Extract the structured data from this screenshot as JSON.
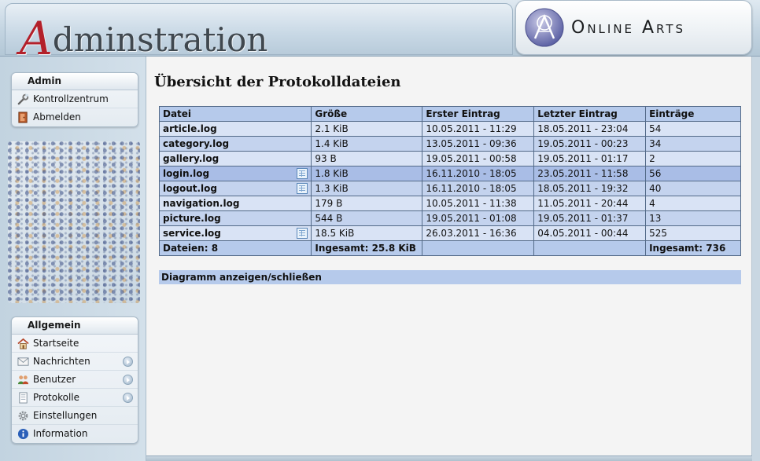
{
  "header": {
    "title_initial": "A",
    "title_rest": "dminstration",
    "brand_name": "Online Arts"
  },
  "sidebar": {
    "admin_panel": {
      "title": "Admin",
      "items": [
        {
          "label": "Kontrollzentrum",
          "icon": "wrench-icon",
          "arrow": false
        },
        {
          "label": "Abmelden",
          "icon": "logout-door-icon",
          "arrow": false
        }
      ]
    },
    "general_panel": {
      "title": "Allgemein",
      "items": [
        {
          "label": "Startseite",
          "icon": "home-icon",
          "arrow": false
        },
        {
          "label": "Nachrichten",
          "icon": "mail-icon",
          "arrow": true
        },
        {
          "label": "Benutzer",
          "icon": "users-icon",
          "arrow": true
        },
        {
          "label": "Protokolle",
          "icon": "document-icon",
          "arrow": true
        },
        {
          "label": "Einstellungen",
          "icon": "gear-icon",
          "arrow": false
        },
        {
          "label": "Information",
          "icon": "info-icon",
          "arrow": false
        }
      ]
    }
  },
  "main": {
    "page_title": "Übersicht der Protokolldateien",
    "table": {
      "headers": [
        "Datei",
        "Größe",
        "Erster Eintrag",
        "Letzter Eintrag",
        "Einträge"
      ],
      "rows": [
        {
          "file": "article.log",
          "size": "2.1 KiB",
          "first": "10.05.2011 - 11:29",
          "last": "18.05.2011 - 23:04",
          "entries": "54",
          "icon": false
        },
        {
          "file": "category.log",
          "size": "1.4 KiB",
          "first": "13.05.2011 - 09:36",
          "last": "19.05.2011 - 00:23",
          "entries": "34",
          "icon": false
        },
        {
          "file": "gallery.log",
          "size": "93 B",
          "first": "19.05.2011 - 00:58",
          "last": "19.05.2011 - 01:17",
          "entries": "2",
          "icon": false
        },
        {
          "file": "login.log",
          "size": "1.8 KiB",
          "first": "16.11.2010 - 18:05",
          "last": "23.05.2011 - 11:58",
          "entries": "56",
          "icon": true
        },
        {
          "file": "logout.log",
          "size": "1.3 KiB",
          "first": "16.11.2010 - 18:05",
          "last": "18.05.2011 - 19:32",
          "entries": "40",
          "icon": true
        },
        {
          "file": "navigation.log",
          "size": "179 B",
          "first": "10.05.2011 - 11:38",
          "last": "11.05.2011 - 20:44",
          "entries": "4",
          "icon": false
        },
        {
          "file": "picture.log",
          "size": "544 B",
          "first": "19.05.2011 - 01:08",
          "last": "19.05.2011 - 01:37",
          "entries": "13",
          "icon": false
        },
        {
          "file": "service.log",
          "size": "18.5 KiB",
          "first": "26.03.2011 - 16:36",
          "last": "04.05.2011 - 00:44",
          "entries": "525",
          "icon": true
        }
      ],
      "footer": {
        "files": "Dateien: 8",
        "total_size": "Ingesamt: 25.8 KiB",
        "total_entries": "Ingesamt: 736"
      }
    },
    "diagram_toggle": "Diagramm anzeigen/schließen"
  }
}
